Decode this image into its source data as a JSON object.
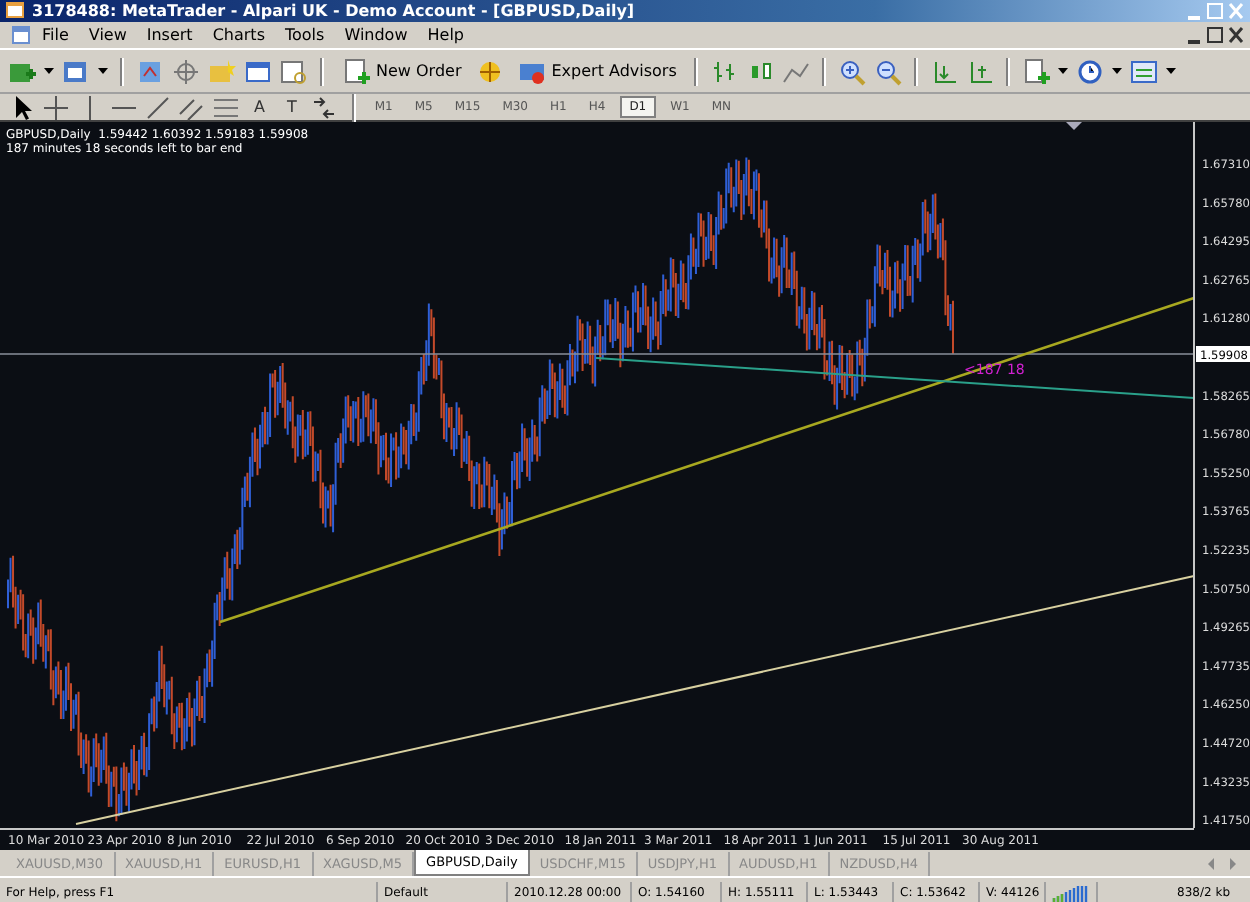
{
  "window": {
    "title": "3178488: MetaTrader - Alpari UK - Demo Account - [GBPUSD,Daily]"
  },
  "menu": [
    "File",
    "View",
    "Insert",
    "Charts",
    "Tools",
    "Window",
    "Help"
  ],
  "toolbar": {
    "new_order": "New Order",
    "expert_advisors": "Expert Advisors"
  },
  "drawing_tools": [
    {
      "kind": "cursor"
    },
    {
      "kind": "crosshair"
    },
    {
      "kind": "vline"
    },
    {
      "kind": "hline"
    },
    {
      "kind": "trendline"
    },
    {
      "kind": "channel"
    },
    {
      "kind": "fibo"
    },
    {
      "kind": "text",
      "label": "A"
    },
    {
      "kind": "text",
      "label": "T"
    },
    {
      "kind": "arrows"
    }
  ],
  "timeframes": [
    {
      "label": "M1",
      "selected": false
    },
    {
      "label": "M5",
      "selected": false
    },
    {
      "label": "M15",
      "selected": false
    },
    {
      "label": "M30",
      "selected": false
    },
    {
      "label": "H1",
      "selected": false
    },
    {
      "label": "H4",
      "selected": false
    },
    {
      "label": "D1",
      "selected": true
    },
    {
      "label": "W1",
      "selected": false
    },
    {
      "label": "MN",
      "selected": false
    }
  ],
  "chart": {
    "header": "GBPUSD,Daily  1.59442 1.60392 1.59183 1.59908",
    "timer": "187 minutes 18 seconds left to bar end",
    "countdown": "<187 18",
    "price_ticks": [
      "1.67310",
      "1.65780",
      "1.64295",
      "1.62765",
      "1.61280",
      "1.58265",
      "1.56780",
      "1.55250",
      "1.53765",
      "1.52235",
      "1.50750",
      "1.49265",
      "1.47735",
      "1.46250",
      "1.44720",
      "1.43235",
      "1.41750"
    ],
    "current_price": "1.59908",
    "dates": [
      "10 Mar 2010",
      "23 Apr 2010",
      "8 Jun 2010",
      "22 Jul 2010",
      "6 Sep 2010",
      "20 Oct 2010",
      "3 Dec 2010",
      "18 Jan 2011",
      "3 Mar 2011",
      "18 Apr 2011",
      "1 Jun 2011",
      "15 Jul 2011",
      "30 Aug 2011"
    ]
  },
  "tabs": [
    {
      "label": "XAUUSD,M30",
      "selected": false
    },
    {
      "label": "XAUUSD,H1",
      "selected": false
    },
    {
      "label": "EURUSD,H1",
      "selected": false
    },
    {
      "label": "XAGUSD,M5",
      "selected": false
    },
    {
      "label": "GBPUSD,Daily",
      "selected": true
    },
    {
      "label": "USDCHF,M15",
      "selected": false
    },
    {
      "label": "USDJPY,H1",
      "selected": false
    },
    {
      "label": "AUDUSD,H1",
      "selected": false
    },
    {
      "label": "NZDUSD,H4",
      "selected": false
    }
  ],
  "status_bar": {
    "help": "For Help, press F1",
    "profile": "Default",
    "time": "2010.12.28 00:00",
    "open": "O: 1.54160",
    "high": "H: 1.55111",
    "low": "L: 1.53443",
    "close": "C: 1.53642",
    "volume": "V: 44126",
    "traffic": "838/2 kb"
  }
}
